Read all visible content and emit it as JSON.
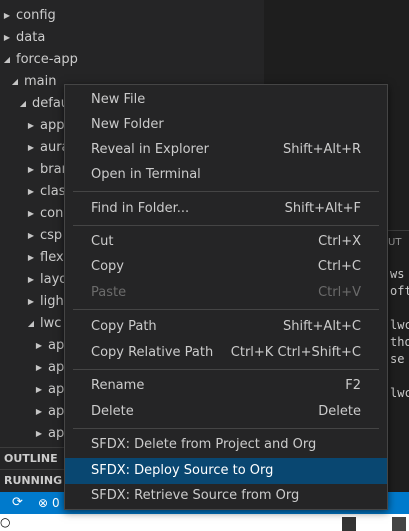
{
  "explorer": {
    "tree": [
      {
        "label": "config",
        "arrow": "▶",
        "indent": 0
      },
      {
        "label": "data",
        "arrow": "▶",
        "indent": 0
      },
      {
        "label": "force-app",
        "arrow": "◢",
        "indent": 0
      },
      {
        "label": "main",
        "arrow": "◢",
        "indent": 1
      },
      {
        "label": "defau",
        "arrow": "◢",
        "indent": 2
      },
      {
        "label": "app",
        "arrow": "▶",
        "indent": 3
      },
      {
        "label": "aura",
        "arrow": "▶",
        "indent": 3
      },
      {
        "label": "bran",
        "arrow": "▶",
        "indent": 3
      },
      {
        "label": "clas",
        "arrow": "▶",
        "indent": 3
      },
      {
        "label": "con",
        "arrow": "▶",
        "indent": 3
      },
      {
        "label": "csp",
        "arrow": "▶",
        "indent": 3
      },
      {
        "label": "flexi",
        "arrow": "▶",
        "indent": 3
      },
      {
        "label": "layo",
        "arrow": "▶",
        "indent": 3
      },
      {
        "label": "ligh",
        "arrow": "▶",
        "indent": 3
      },
      {
        "label": "lwc",
        "arrow": "◢",
        "indent": 3
      },
      {
        "label": "ap",
        "arrow": "▶",
        "indent": 4
      },
      {
        "label": "ap",
        "arrow": "▶",
        "indent": 4
      },
      {
        "label": "ap",
        "arrow": "▶",
        "indent": 4
      },
      {
        "label": "ap",
        "arrow": "▶",
        "indent": 4
      },
      {
        "label": "ap",
        "arrow": "▶",
        "indent": 4
      }
    ],
    "outline_label": "OUTLINE",
    "running_label": "RUNNING T"
  },
  "panel": {
    "tab_label": "UT",
    "lines": [
      "ws",
      "oft",
      "",
      "lwc",
      "tho",
      "se",
      "",
      "lwc"
    ]
  },
  "statusbar": {
    "sync_icon": "sync-icon",
    "errors_icon": "error-icon",
    "errors_count": "0"
  },
  "context_menu": {
    "items": [
      {
        "label": "New File",
        "shortcut": "",
        "disabled": false,
        "selected": false
      },
      {
        "label": "New Folder",
        "shortcut": "",
        "disabled": false,
        "selected": false
      },
      {
        "label": "Reveal in Explorer",
        "shortcut": "Shift+Alt+R",
        "disabled": false,
        "selected": false
      },
      {
        "label": "Open in Terminal",
        "shortcut": "",
        "disabled": false,
        "selected": false
      },
      {
        "label": "Find in Folder...",
        "shortcut": "Shift+Alt+F",
        "disabled": false,
        "selected": false
      },
      {
        "label": "Cut",
        "shortcut": "Ctrl+X",
        "disabled": false,
        "selected": false
      },
      {
        "label": "Copy",
        "shortcut": "Ctrl+C",
        "disabled": false,
        "selected": false
      },
      {
        "label": "Paste",
        "shortcut": "Ctrl+V",
        "disabled": true,
        "selected": false
      },
      {
        "label": "Copy Path",
        "shortcut": "Shift+Alt+C",
        "disabled": false,
        "selected": false
      },
      {
        "label": "Copy Relative Path",
        "shortcut": "Ctrl+K Ctrl+Shift+C",
        "disabled": false,
        "selected": false
      },
      {
        "label": "Rename",
        "shortcut": "F2",
        "disabled": false,
        "selected": false
      },
      {
        "label": "Delete",
        "shortcut": "Delete",
        "disabled": false,
        "selected": false
      },
      {
        "label": "SFDX: Delete from Project and Org",
        "shortcut": "",
        "disabled": false,
        "selected": false
      },
      {
        "label": "SFDX: Deploy Source to Org",
        "shortcut": "",
        "disabled": false,
        "selected": true
      },
      {
        "label": "SFDX: Retrieve Source from Org",
        "shortcut": "",
        "disabled": false,
        "selected": false
      }
    ]
  },
  "colors": {
    "sidebar_bg": "#252526",
    "editor_bg": "#1e1e1e",
    "menu_selected": "#094771",
    "statusbar_bg": "#007acc"
  }
}
